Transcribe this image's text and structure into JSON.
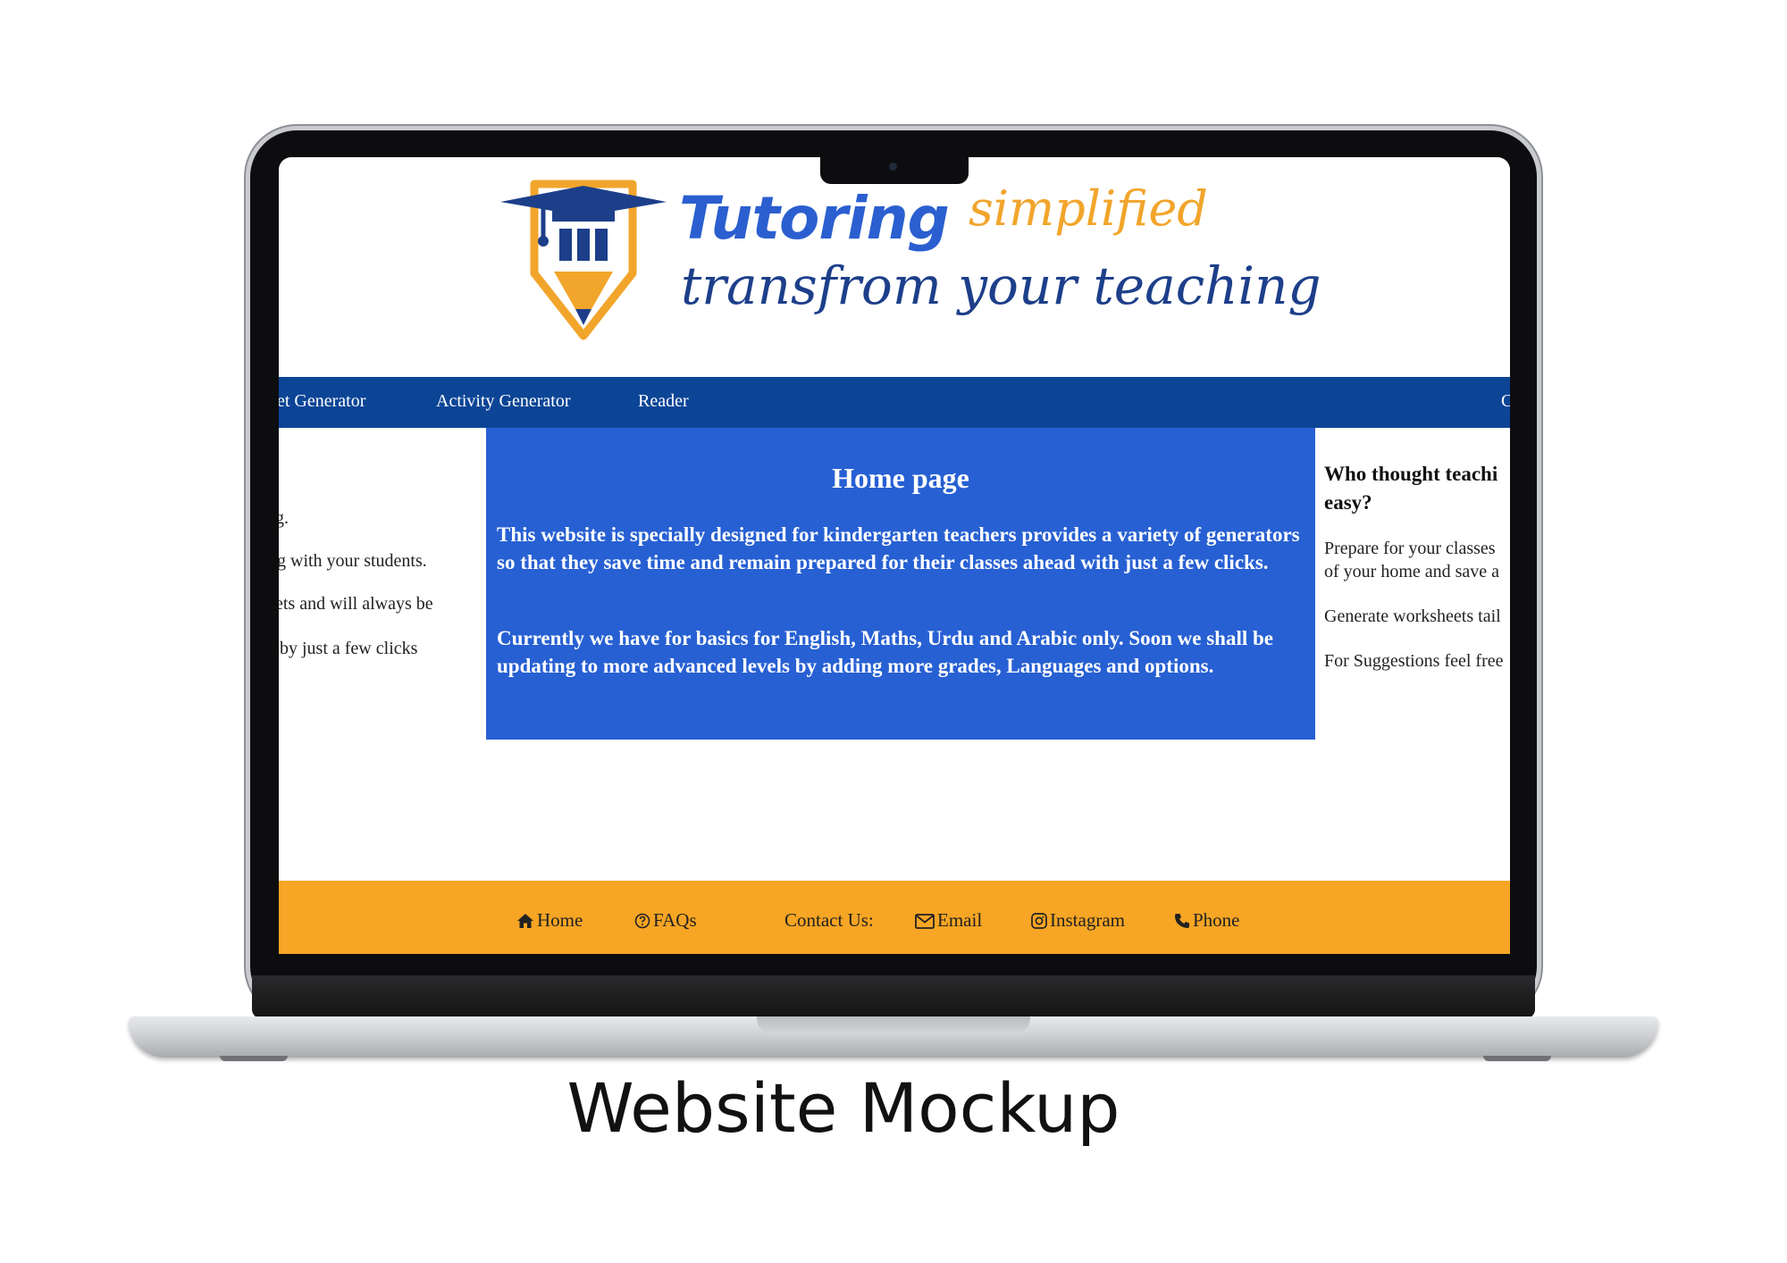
{
  "brand": {
    "main": "Tutoring",
    "sub": "simplified",
    "tagline": "transfrom your teaching"
  },
  "nav": {
    "items": [
      "et Generator",
      "Activity Generator",
      "Reader",
      "C"
    ]
  },
  "left": {
    "lines": [
      "g.",
      "g with your students.",
      "ets and will always be",
      " by just a few clicks"
    ]
  },
  "hero": {
    "title": "Home page",
    "para1": "This website is specially designed for kindergarten teachers provides a variety of generators so that they save time and remain prepared for their classes ahead with just a few clicks.",
    "para2": "Currently we have for basics for English, Maths, Urdu and Arabic only. Soon we shall be updating to more advanced levels by adding more grades, Languages and options."
  },
  "right": {
    "heading": "Who thought teachі easy?",
    "heading_line1": "Who thought teachi",
    "heading_line2": "easy?",
    "p1_line1": "Prepare for your classes",
    "p1_line2": "of your home and save a",
    "p2": "Generate worksheets tail",
    "p3": "For Suggestions feel free"
  },
  "footer": {
    "home": "Home",
    "faqs": "FAQs",
    "contact": "Contact Us:",
    "email": "Email",
    "instagram": "Instagram",
    "phone": "Phone"
  },
  "colors": {
    "nav": "#0c4596",
    "hero": "#2760d3",
    "footer": "#f6a524",
    "brand_blue": "#2b5fd0",
    "brand_orange": "#f2a52b"
  },
  "caption": "Website Mockup"
}
